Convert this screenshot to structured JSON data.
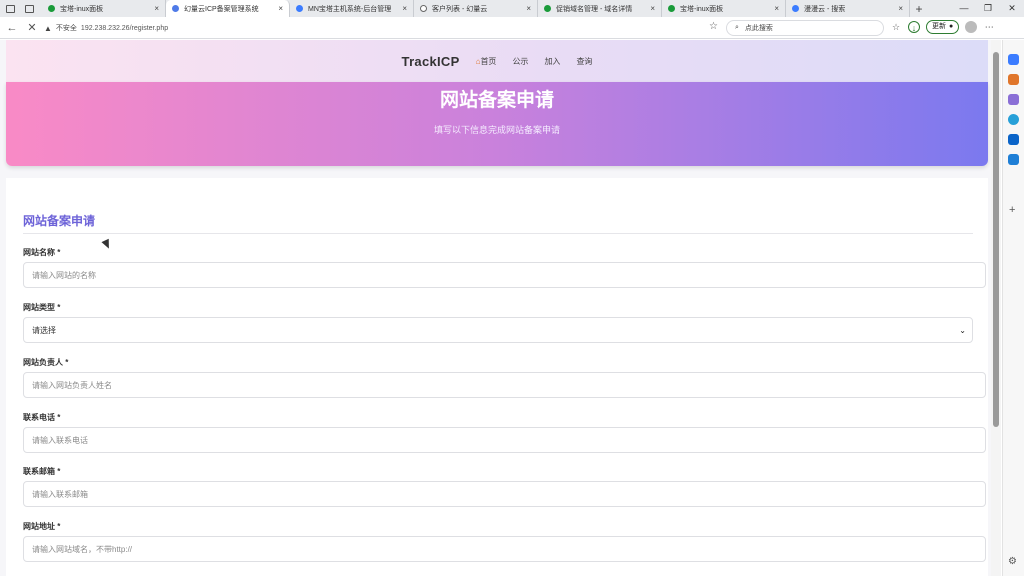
{
  "browser": {
    "tabs": [
      {
        "title": "宝塔-inux面板",
        "color": "#1a9b3a"
      },
      {
        "title": "幻量云ICP备案管理系统",
        "color": "#4f7be8",
        "active": true
      },
      {
        "title": "MN宝塔主机系统-后台管理",
        "color": "#3b7cff"
      },
      {
        "title": "客户列表 - 幻量云",
        "color": "#666666"
      },
      {
        "title": "促销域名管理 - 域名详情",
        "color": "#1a9b3a"
      },
      {
        "title": "宝塔-inux面板",
        "color": "#1a9b3a"
      },
      {
        "title": "漫漫云 - 搜索",
        "color": "#3b7cff"
      }
    ],
    "tab_close": "×",
    "new_tab": "+",
    "window_controls": {
      "minimize": "—",
      "restore": "❐",
      "close": "✕"
    },
    "security_label": "不安全",
    "url": "192.238.232.26/register.php",
    "search_placeholder": "点此搜索",
    "update_label": "更新",
    "back_glyph": "←",
    "reload_glyph": "✕",
    "star_glyph": "☆"
  },
  "site": {
    "brand": "TrackICP",
    "nav": {
      "home": "首页",
      "notice": "公示",
      "join": "加入",
      "query": "查询"
    },
    "hero": {
      "title": "网站备案申请",
      "subtitle": "填写以下信息完成网站备案申请"
    },
    "form": {
      "title": "网站备案申请",
      "site_name": {
        "label": "网站名称 *",
        "placeholder": "请输入网站的名称"
      },
      "site_type": {
        "label": "网站类型 *",
        "value": "请选择"
      },
      "owner": {
        "label": "网站负责人 *",
        "placeholder": "请输入网站负责人姓名"
      },
      "phone": {
        "label": "联系电话 *",
        "placeholder": "请输入联系电话"
      },
      "email": {
        "label": "联系邮箱 *",
        "placeholder": "请输入联系邮箱"
      },
      "url": {
        "label": "网站地址 *",
        "placeholder": "请输入网站域名，不带http://"
      }
    }
  },
  "colors": {
    "hero_start": "#f98ac6",
    "hero_end": "#7b79ef",
    "form_title": "#6d63d8"
  }
}
